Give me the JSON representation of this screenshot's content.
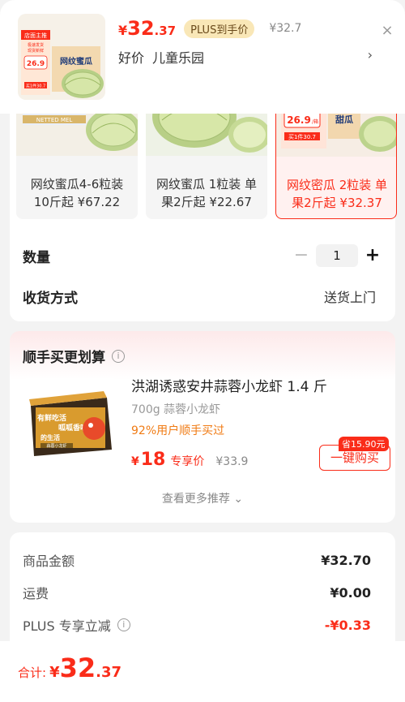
{
  "header": {
    "price_symbol": "¥",
    "price_int": "32",
    "price_dec": ".37",
    "plus_badge": "PLUS到手价",
    "price_strike": "¥32.7",
    "tags": [
      "好价",
      "儿童乐园"
    ],
    "chevron": "›",
    "close": "×",
    "thumb_text": {
      "banner": "店面主推",
      "sub1": "极速发货",
      "sub2": "现货新鲜",
      "brand": "网纹蜜瓜",
      "price": "26.9",
      "unit": "/箱",
      "buy1": "买1件30.7"
    }
  },
  "options": [
    {
      "line1": "网纹蜜瓜4-6粒装",
      "line2": "10斤起 ¥67.22",
      "selected": false,
      "pic_tag": "NETTED MEL"
    },
    {
      "line1": "网纹蜜瓜 1粒装 单",
      "line2": "果2斤起 ¥22.67",
      "selected": false,
      "pic_tag": ""
    },
    {
      "line1": "网纹密瓜 2粒装 单",
      "line2": "果2斤起 ¥32.37",
      "selected": true,
      "pic_tag": "26.9",
      "pic_unit": "/箱",
      "pic_buy": "买1件30.7",
      "pic_brand": "甜瓜"
    }
  ],
  "quantity": {
    "label": "数量",
    "value": "1",
    "minus": "−",
    "plus": "+"
  },
  "shipping": {
    "label": "收货方式",
    "value": "送货上门"
  },
  "upsell": {
    "title": "顺手买更划算",
    "name": "洪湖诱惑安井蒜蓉小龙虾 1.4 斤",
    "spec": "700g 蒜蓉小龙虾",
    "stat": "92%用户顺手买过",
    "price_symbol": "¥",
    "price": "18",
    "price_tag": "专享价",
    "orig_price": "¥33.9",
    "save_badge": "省15.90元",
    "buy_button": "一键购买",
    "more": "查看更多推荐 ⌄",
    "img_text": {
      "l1": "有鲜吃活",
      "l2": "呱呱香味",
      "l3": "的生活",
      "brand": "蒜蓉小龙虾"
    }
  },
  "summary": [
    {
      "key": "商品金额",
      "value": "¥32.70",
      "red": false,
      "info": false
    },
    {
      "key": "运费",
      "value": "¥0.00",
      "red": false,
      "info": false
    },
    {
      "key": "PLUS 专享立减",
      "value": "-¥0.33",
      "red": true,
      "info": true
    }
  ],
  "footer": {
    "label": "合计:",
    "symbol": "¥",
    "int": "32",
    "dec": ".37"
  },
  "colors": {
    "accent": "#fa2c19",
    "plus_gold": "#f9e7b7",
    "bg": "#f3f3f3"
  }
}
